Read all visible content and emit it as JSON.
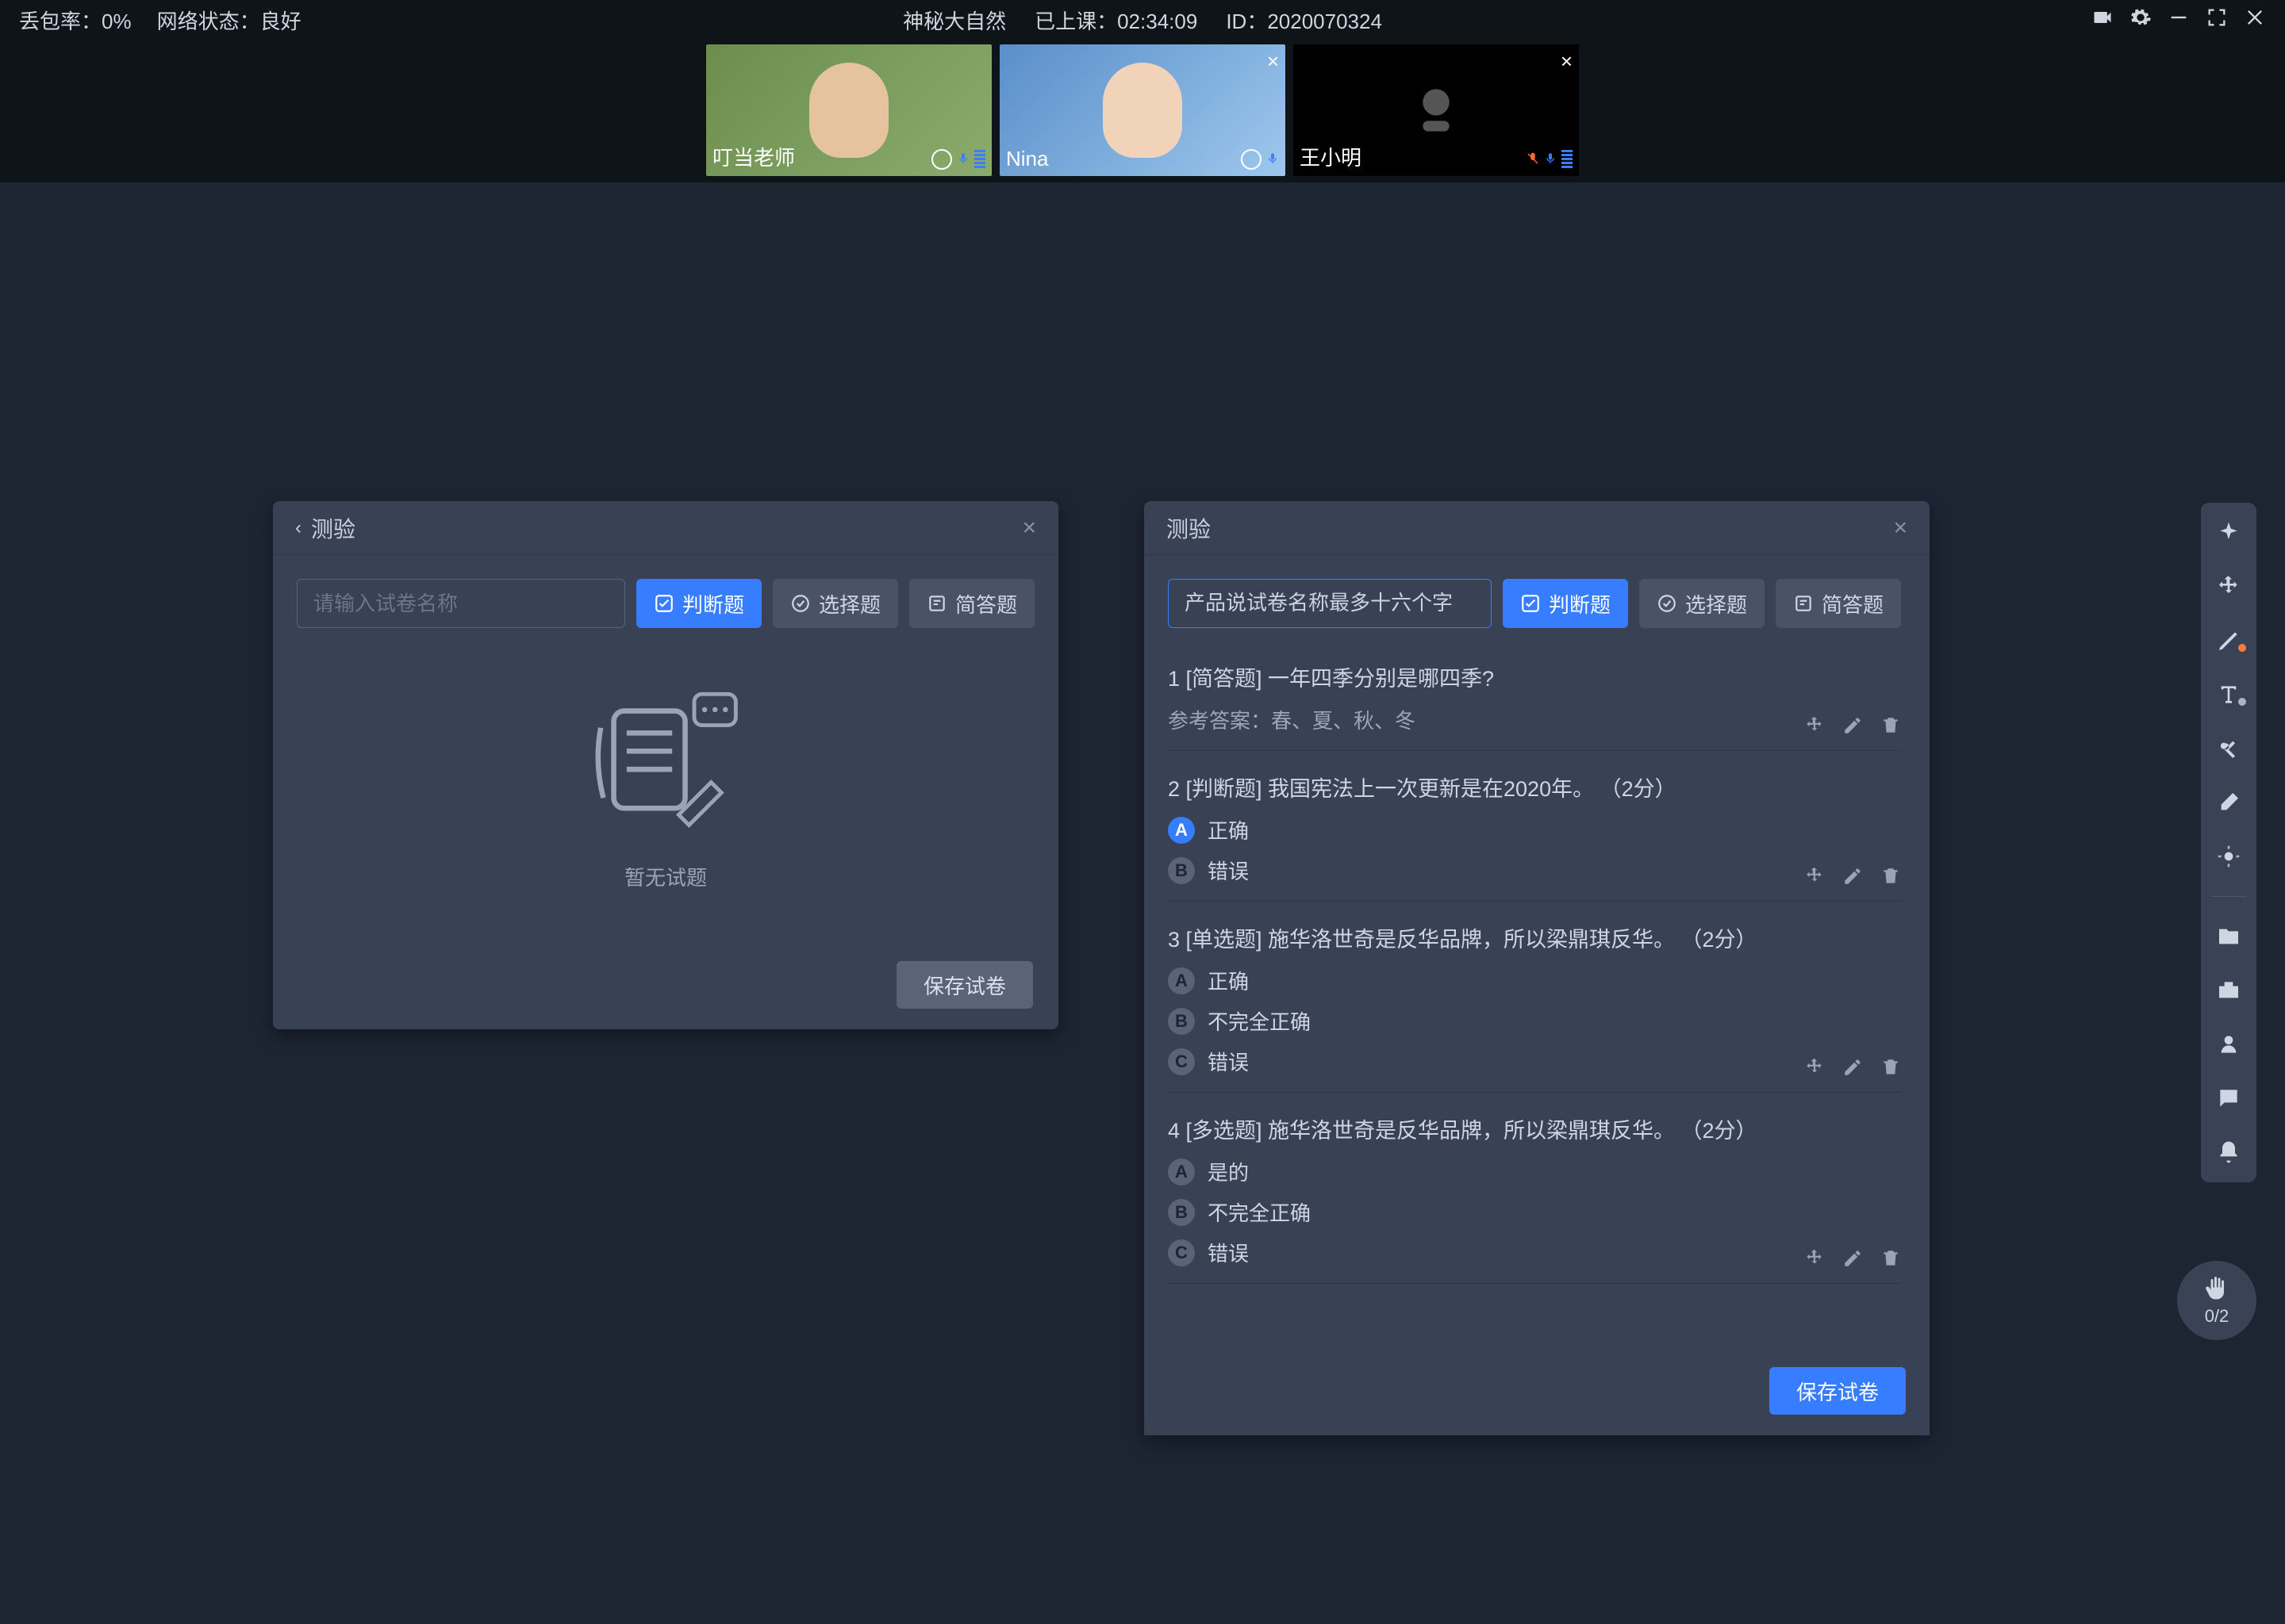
{
  "topbar": {
    "packet_loss_label": "丢包率：",
    "packet_loss_value": "0%",
    "network_label": "网络状态：",
    "network_value": "良好",
    "course_title": "神秘大自然",
    "elapsed_label": "已上课：",
    "elapsed_value": "02:34:09",
    "id_label": "ID：",
    "id_value": "2020070324"
  },
  "videos": [
    {
      "name": "叮当老师",
      "kind": "teacher",
      "camera": true,
      "mic": "on",
      "closable": false
    },
    {
      "name": "Nina",
      "kind": "student",
      "camera": true,
      "mic": "on",
      "closable": true
    },
    {
      "name": "王小明",
      "kind": "student",
      "camera": false,
      "mic": "off",
      "closable": true
    }
  ],
  "panel_left": {
    "title": "测验",
    "name_placeholder": "请输入试卷名称",
    "buttons": {
      "judge": "判断题",
      "choice": "选择题",
      "short": "简答题"
    },
    "empty_text": "暂无试题",
    "save_label": "保存试卷"
  },
  "panel_right": {
    "title": "测验",
    "name_value": "产品说试卷名称最多十六个字",
    "buttons": {
      "judge": "判断题",
      "choice": "选择题",
      "short": "简答题"
    },
    "questions": [
      {
        "idx": "1",
        "tag": "[简答题]",
        "text": "一年四季分别是哪四季?",
        "ref_label": "参考答案：",
        "ref_answer": "春、夏、秋、冬",
        "options": []
      },
      {
        "idx": "2",
        "tag": "[判断题]",
        "text": "我国宪法上一次更新是在2020年。",
        "score": "（2分）",
        "options": [
          {
            "letter": "A",
            "text": "正确",
            "correct": true
          },
          {
            "letter": "B",
            "text": "错误",
            "correct": false
          }
        ]
      },
      {
        "idx": "3",
        "tag": "[单选题]",
        "text": "施华洛世奇是反华品牌，所以梁鼎琪反华。",
        "score": "（2分）",
        "options": [
          {
            "letter": "A",
            "text": "正确",
            "correct": false
          },
          {
            "letter": "B",
            "text": "不完全正确",
            "correct": false
          },
          {
            "letter": "C",
            "text": "错误",
            "correct": false
          }
        ]
      },
      {
        "idx": "4",
        "tag": "[多选题]",
        "text": "施华洛世奇是反华品牌，所以梁鼎琪反华。",
        "score": "（2分）",
        "options": [
          {
            "letter": "A",
            "text": "是的",
            "correct": false
          },
          {
            "letter": "B",
            "text": "不完全正确",
            "correct": false
          },
          {
            "letter": "C",
            "text": "错误",
            "correct": false
          }
        ]
      }
    ],
    "save_label": "保存试卷"
  },
  "toolbar_items": [
    {
      "id": "cursor",
      "name": "cursor-click-icon",
      "dot": null
    },
    {
      "id": "move",
      "name": "move-icon",
      "dot": null
    },
    {
      "id": "pen",
      "name": "pen-icon",
      "dot": "#ff7a3c"
    },
    {
      "id": "text",
      "name": "text-tool-icon",
      "dot": "#a8b3c9"
    },
    {
      "id": "scissors",
      "name": "scissors-icon",
      "dot": null
    },
    {
      "id": "eraser",
      "name": "eraser-icon",
      "dot": null
    },
    {
      "id": "brightness",
      "name": "brightness-icon",
      "dot": null
    },
    {
      "sep": true
    },
    {
      "id": "folder",
      "name": "folder-icon",
      "dot": null
    },
    {
      "id": "toolbox",
      "name": "toolbox-icon",
      "dot": null
    },
    {
      "id": "user",
      "name": "profile-icon",
      "dot": null
    },
    {
      "id": "chat",
      "name": "chat-icon",
      "dot": null
    },
    {
      "id": "bell",
      "name": "bell-icon",
      "dot": null
    }
  ],
  "hand": {
    "count": "0/2"
  }
}
